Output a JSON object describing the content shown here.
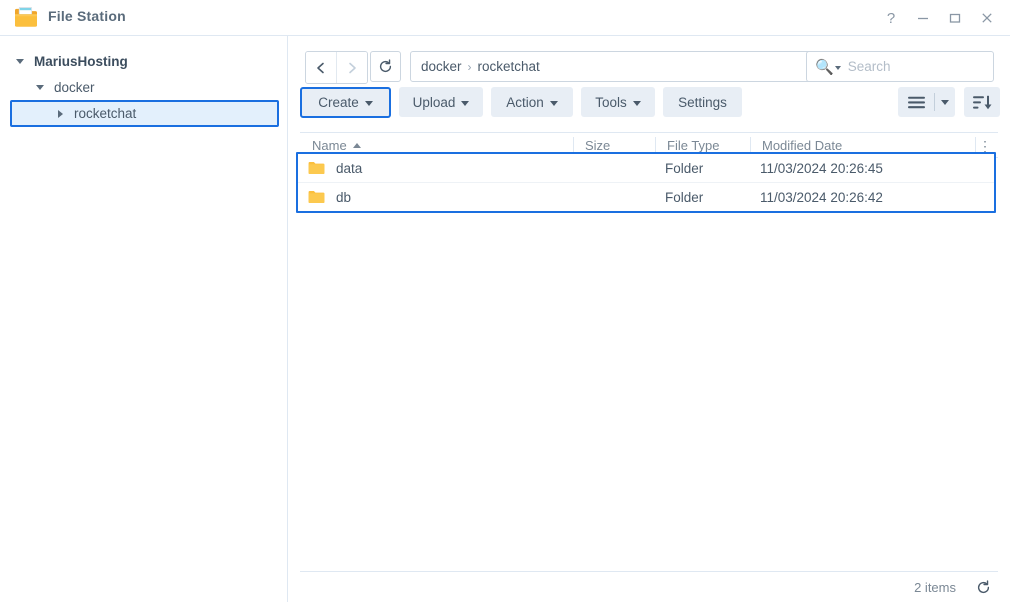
{
  "window": {
    "app_title": "File Station",
    "app_icon": "folder-icon",
    "controls": {
      "help": "?",
      "minimize": "minimize-icon",
      "maximize": "maximize-icon",
      "close": "close-icon"
    }
  },
  "sidebar": {
    "tree": [
      {
        "label": "MariusHosting",
        "level": 0,
        "expanded": true,
        "selected": false
      },
      {
        "label": "docker",
        "level": 1,
        "expanded": true,
        "selected": false
      },
      {
        "label": "rocketchat",
        "level": 2,
        "expanded": false,
        "selected": true
      }
    ]
  },
  "nav": {
    "back": "back-arrow-icon",
    "forward": "forward-arrow-icon",
    "refresh": "refresh-icon",
    "path_crumbs": [
      "docker",
      "rocketchat"
    ],
    "path_separator": "›",
    "favorite_icon": "star-icon"
  },
  "search": {
    "icon": "search-icon",
    "placeholder": "Search",
    "value": ""
  },
  "toolbar": {
    "buttons": [
      {
        "label": "Create",
        "caret": true,
        "primary": true
      },
      {
        "label": "Upload",
        "caret": true,
        "primary": false
      },
      {
        "label": "Action",
        "caret": true,
        "primary": false
      },
      {
        "label": "Tools",
        "caret": true,
        "primary": false
      },
      {
        "label": "Settings",
        "caret": false,
        "primary": false
      }
    ],
    "view_mode_icon": "list-view-icon",
    "view_mode_caret": "chevron-down-icon",
    "sort_icon": "sort-descending-icon"
  },
  "table": {
    "columns": [
      {
        "key": "name",
        "label": "Name",
        "sort": "asc"
      },
      {
        "key": "size",
        "label": "Size",
        "sort": ""
      },
      {
        "key": "filetype",
        "label": "File Type",
        "sort": ""
      },
      {
        "key": "modified",
        "label": "Modified Date",
        "sort": ""
      }
    ],
    "column_menu_icon": "more-vertical-icon",
    "rows": [
      {
        "icon": "folder-icon",
        "name": "data",
        "size": "",
        "filetype": "Folder",
        "modified": "11/03/2024 20:26:45"
      },
      {
        "icon": "folder-icon",
        "name": "db",
        "size": "",
        "filetype": "Folder",
        "modified": "11/03/2024 20:26:42"
      }
    ]
  },
  "status": {
    "items_text": "2 items",
    "refresh_icon": "refresh-icon"
  },
  "colors": {
    "selection_blue": "#1a6fe0",
    "selection_fill": "#e3f0fc",
    "folder_amber": "#f9b233",
    "toolbar_button": "#e8eef5",
    "text": "#4a5a6a",
    "muted_text": "#7b8895",
    "divider": "#dfe8f2"
  }
}
